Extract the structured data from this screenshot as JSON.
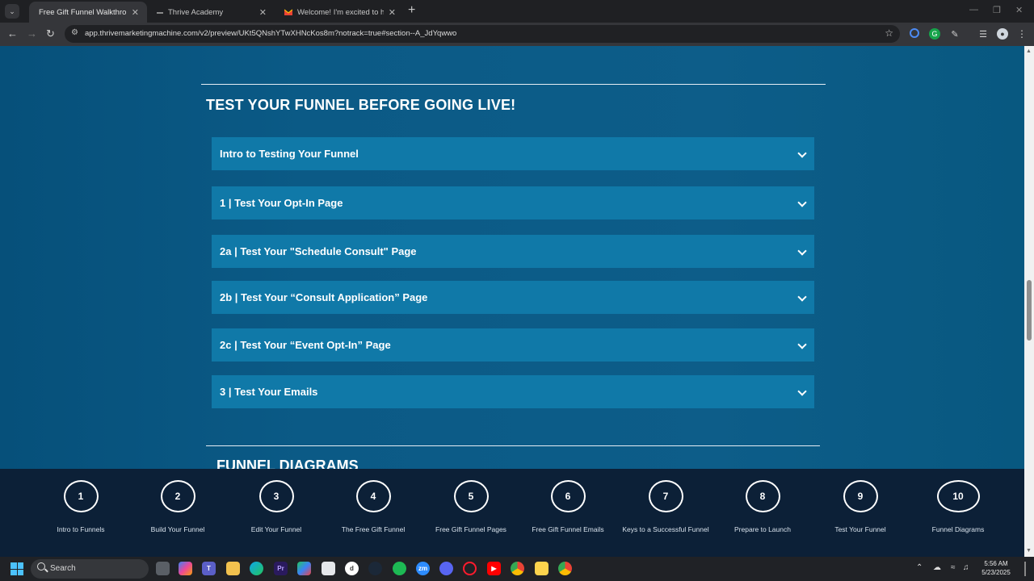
{
  "browser": {
    "tabs": [
      {
        "title": "Free Gift Funnel Walkthrough (",
        "active": true
      },
      {
        "title": "Thrive Academy",
        "active": false
      },
      {
        "title": "Welcome! I'm excited to help y",
        "active": false
      }
    ],
    "new_tab_symbol": "+",
    "url": "app.thrivemarketingmachine.com/v2/preview/UKt5QNshYTwXHNcKos8m?notrack=true#section--A_JdYqwwo",
    "colors": {
      "tab_strip": "#1f2023",
      "toolbar": "#35363a",
      "omnibox": "#202124"
    }
  },
  "page": {
    "section_title": "TEST YOUR FUNNEL BEFORE GOING LIVE!",
    "accordion": [
      {
        "label": "Intro to Testing Your Funnel"
      },
      {
        "label": "1 | Test Your Opt-In Page"
      },
      {
        "label": "2a | Test Your \"Schedule Consult\" Page"
      },
      {
        "label": "2b | Test Your “Consult Application” Page"
      },
      {
        "label": "2c | Test Your “Event Opt-In” Page"
      },
      {
        "label": "3 | Test Your Emails"
      }
    ],
    "next_section_title": "FUNNEL DIAGRAMS",
    "colors": {
      "accordion_bg": "#1079a8",
      "page_bg": "#0b5a86",
      "stepnav_bg": "#0c2037"
    }
  },
  "stepnav": {
    "steps": [
      {
        "number": "1",
        "label": "Intro to Funnels"
      },
      {
        "number": "2",
        "label": "Build Your Funnel"
      },
      {
        "number": "3",
        "label": "Edit Your Funnel"
      },
      {
        "number": "4",
        "label": "The Free Gift Funnel"
      },
      {
        "number": "5",
        "label": "Free Gift Funnel Pages"
      },
      {
        "number": "6",
        "label": "Free Gift Funnel Emails"
      },
      {
        "number": "7",
        "label": "Keys to a Successful Funnel"
      },
      {
        "number": "8",
        "label": "Prepare to Launch"
      },
      {
        "number": "9",
        "label": "Test Your Funnel"
      },
      {
        "number": "10",
        "label": "Funnel Diagrams"
      }
    ]
  },
  "taskbar": {
    "search_label": "Search",
    "time": "5:56 AM",
    "date": "5/23/2025",
    "apps": [
      "file-explorer-icon",
      "copilot-icon",
      "teams-icon",
      "folder-icon",
      "edge-icon",
      "premiere-icon",
      "photos-icon",
      "store-icon",
      "app-icon",
      "steam-icon",
      "spotify-icon",
      "zoom-icon",
      "discord-icon",
      "opera-icon",
      "youtube-icon",
      "chrome-icon",
      "sticky-notes-icon",
      "chrome-profile-icon"
    ]
  }
}
